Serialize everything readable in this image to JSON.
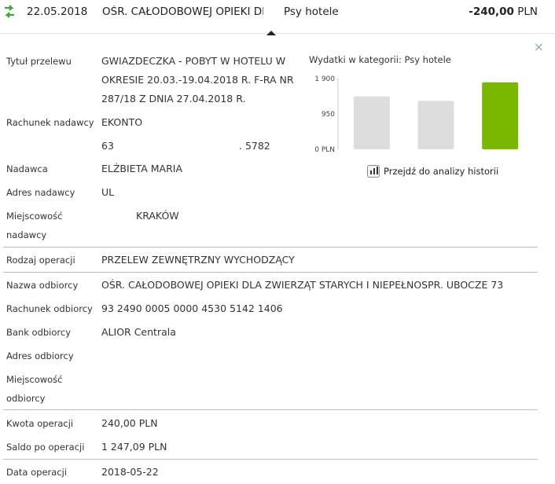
{
  "header": {
    "date": "22.05.2018",
    "name": "OŚR. CAŁODOBOWEJ OPIEKI DL...",
    "category": "Psy hotele",
    "amount": "-240,00",
    "currency": "PLN"
  },
  "close_label": "×",
  "details": {
    "title_label": "Tytuł przelewu",
    "title_lines": [
      "GWIAZDECZKA - POBYT W HOTELU W",
      "OKRESIE 20.03.-19.04.2018 R. F-RA NR",
      "287/18 Z DNIA 27.04.2018 R."
    ],
    "sender_account_label": "Rachunek nadawcy",
    "sender_account_name": "EKONTO",
    "sender_account_number_start": "63",
    "sender_account_number_end": ". 5782",
    "sender_label": "Nadawca",
    "sender_value": "ELŻBIETA MARIA",
    "sender_address_label": "Adres nadawcy",
    "sender_address_value": "UL",
    "sender_city_label_1": "Miejscowość",
    "sender_city_label_2": "nadawcy",
    "sender_city_value": "KRAKÓW",
    "operation_type_label": "Rodzaj operacji",
    "operation_type_value": "PRZELEW ZEWNĘTRZNY WYCHODZĄCY",
    "recipient_name_label": "Nazwa odbiorcy",
    "recipient_name_value": "OŚR. CAŁODOBOWEJ OPIEKI DLA ZWIERZĄT STARYCH I NIEPEŁNOSPR. UBOCZE 73",
    "recipient_account_label": "Rachunek odbiorcy",
    "recipient_account_value": "93 2490 0005 0000 4530 5142 1406",
    "recipient_bank_label": "Bank odbiorcy",
    "recipient_bank_value": "ALIOR Centrala",
    "recipient_address_label": "Adres odbiorcy",
    "recipient_city_label_1": "Miejscowość",
    "recipient_city_label_2": "odbiorcy",
    "amount_label": "Kwota operacji",
    "amount_value": "240,00 PLN",
    "balance_label": "Saldo po operacji",
    "balance_value": "1 247,09 PLN",
    "date_label": "Data operacji",
    "date_value": "2018-05-22"
  },
  "chart_title": "Wydatki w kategorii:  Psy hotele",
  "history_link": "Przejdź do analizy historii",
  "chart_data": {
    "type": "bar",
    "categories": [
      "",
      "",
      ""
    ],
    "values": [
      1420,
      1300,
      1800
    ],
    "colors": [
      "#dddddd",
      "#dddddd",
      "#7ab800"
    ],
    "ylim": [
      0,
      1900
    ],
    "yticks": [
      0,
      950,
      1900
    ],
    "ytick_labels": [
      "0 PLN",
      "950",
      "1 900"
    ],
    "title": "Wydatki w kategorii:  Psy hotele"
  },
  "colors": {
    "accent": "#7ab800",
    "icon_green": "#3aa63a",
    "separator": "#bdbdbd"
  }
}
